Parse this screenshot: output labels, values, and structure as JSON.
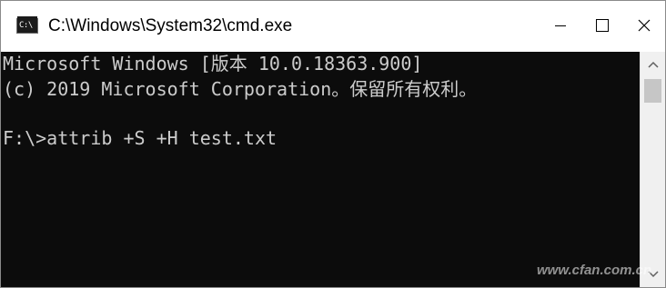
{
  "window": {
    "title": "C:\\Windows\\System32\\cmd.exe",
    "icon": "cmd-icon",
    "icon_text": "C:\\"
  },
  "caption_buttons": {
    "minimize_icon": "minimize-icon",
    "maximize_icon": "maximize-icon",
    "close_icon": "close-icon"
  },
  "console": {
    "lines": [
      "Microsoft Windows [版本 10.0.18363.900]",
      "(c) 2019 Microsoft Corporation。保留所有权利。",
      "F:\\>attrib +S +H test.txt"
    ],
    "background": "#0c0c0c",
    "foreground": "#cccccc"
  },
  "scrollbar": {
    "up_icon": "scroll-up-arrow-icon",
    "down_icon": "scroll-down-arrow-icon"
  },
  "watermark": {
    "text": "www.cfan.com.cn"
  }
}
